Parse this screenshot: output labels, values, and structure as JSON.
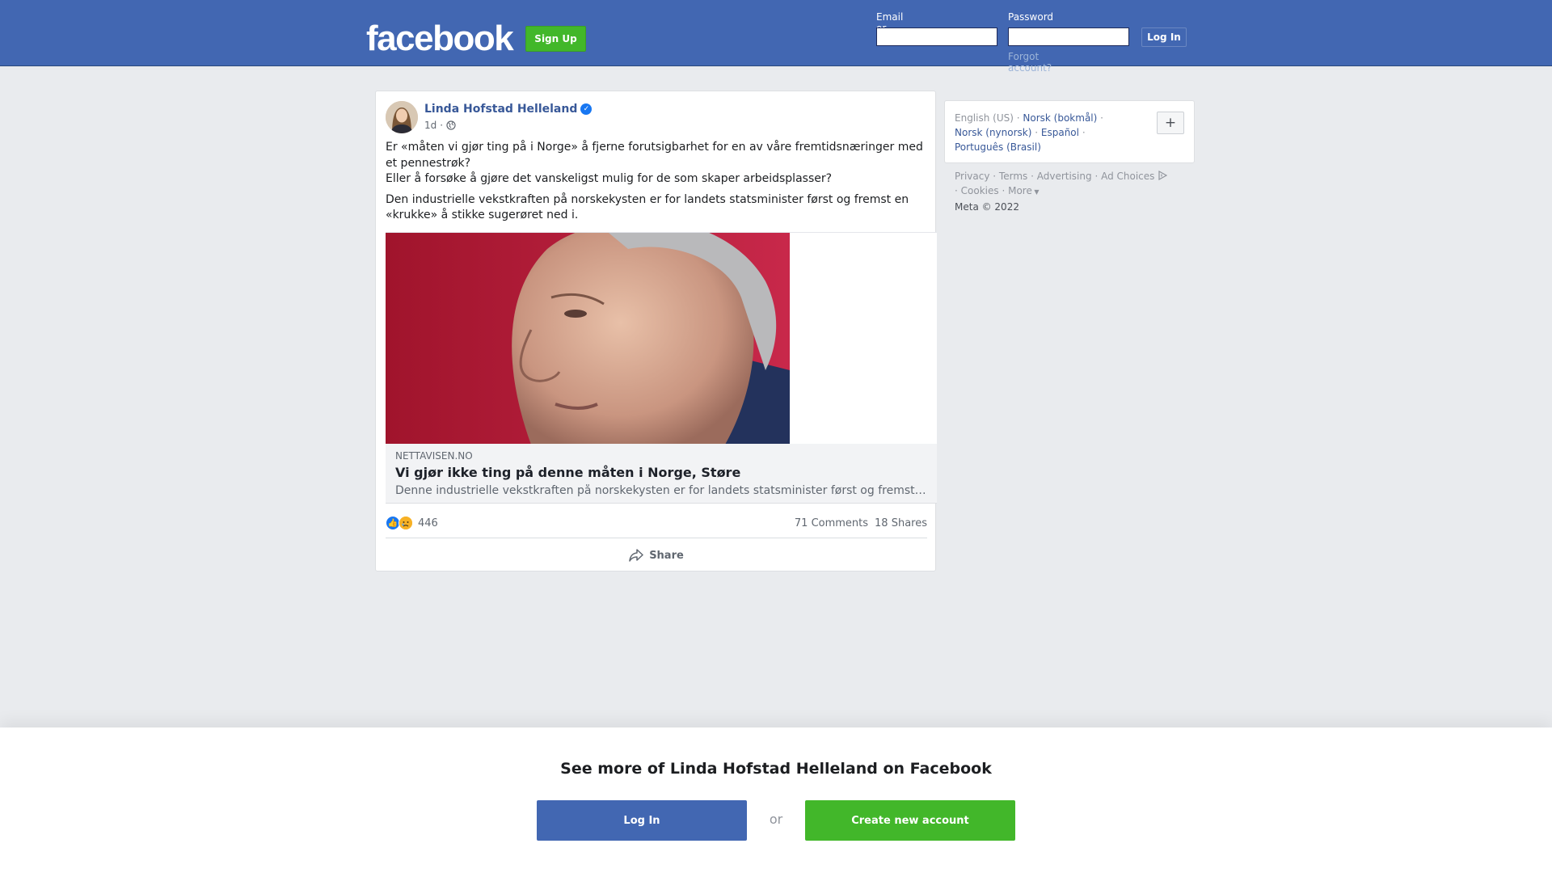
{
  "header": {
    "logo_text": "facebook",
    "signup_label": "Sign Up",
    "email_label": "Email or phone",
    "password_label": "Password",
    "login_label": "Log In",
    "forgot_label": "Forgot account?"
  },
  "post": {
    "author": "Linda Hofstad Helleland",
    "time": "1d",
    "paragraphs": [
      "Er «måten vi gjør ting på i Norge» å fjerne forutsigbarhet for en av våre fremtidsnæringer med et pennestrøk?",
      "Eller å forsøke å gjøre det vanskeligst mulig for de som skaper arbeidsplasser?",
      "Den industrielle vekstkraften på norskekysten er for landets statsminister først og fremst en «krukke» å stikke sugerøret ned i."
    ],
    "link": {
      "domain": "NETTAVISEN.NO",
      "title": "Vi gjør ikke ting på denne måten i Norge, Støre",
      "description": "Denne industrielle vekstkraften på norskekysten er for landets statsminister først og fremst en «krukke» å stikke sugerøret ned i."
    },
    "reaction_count": "446",
    "comments": "71 Comments",
    "shares": "18 Shares",
    "share_label": "Share"
  },
  "sidebar": {
    "languages": {
      "current": "English (US)",
      "norsk_bokmal": "Norsk (bokmål)",
      "norsk_nynorsk": "Norsk (nynorsk)",
      "espanol": "Español",
      "portugues": "Português (Brasil)",
      "plus": "+"
    },
    "footer": {
      "privacy": "Privacy",
      "terms": "Terms",
      "advertising": "Advertising",
      "ad_choices": "Ad Choices",
      "cookies": "Cookies",
      "more": "More",
      "copyright": "Meta © 2022"
    }
  },
  "banner": {
    "title": "See more of Linda Hofstad Helleland on Facebook",
    "login_label": "Log In",
    "or_label": "or",
    "create_label": "Create new account"
  },
  "colors": {
    "brand_blue": "#4267b2",
    "green": "#42b72a",
    "link_blue": "#385898"
  }
}
